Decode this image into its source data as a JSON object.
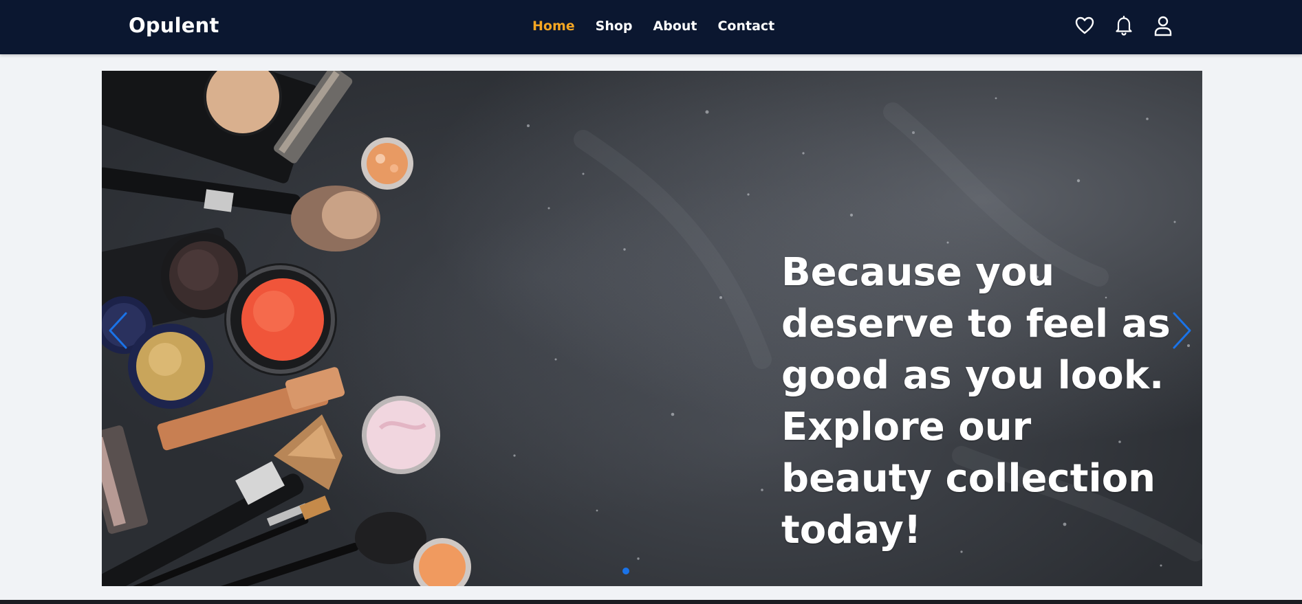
{
  "brand": {
    "name": "Opulent"
  },
  "nav": {
    "links": [
      {
        "label": "Home",
        "active": true
      },
      {
        "label": "Shop",
        "active": false
      },
      {
        "label": "About",
        "active": false
      },
      {
        "label": "Contact",
        "active": false
      }
    ],
    "icons": [
      "heart-icon",
      "bell-icon",
      "user-icon"
    ]
  },
  "hero": {
    "caption": "Because you deserve to feel as good as you look. Explore our beauty collection today!",
    "slides_count": 1,
    "active_slide": 1
  },
  "colors": {
    "navbar_bg": "#0b1730",
    "active_link": "#f5a623",
    "accent": "#1a73e8",
    "page_bg": "#f1f3f6"
  }
}
